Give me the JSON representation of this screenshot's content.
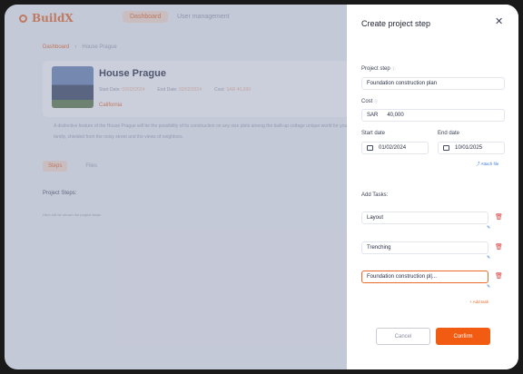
{
  "app": {
    "logo_text": "BuildX",
    "nav": [
      "Dashboard",
      "User management"
    ]
  },
  "breadcrumb": [
    "Dashboard",
    "House Prague"
  ],
  "project": {
    "title": "House Prague",
    "start_label": "Start Date:",
    "start_value": "02/02/2024",
    "end_label": "End Date:",
    "end_value": "02/02/2024",
    "cost_label": "Cost:",
    "cost_value": "SAR 40,000",
    "location": "California",
    "description": "A distinctive feature of the House Prague will be the possibility of its construction on any size plots among the built-up cottage unique world for your family, shielded from the noisy street and the views of neighbors."
  },
  "tabs": [
    "Steps",
    "Files"
  ],
  "steps": {
    "heading": "Project Steps:",
    "empty": "Here will be shown the project steps"
  },
  "panel": {
    "title": "Create project step",
    "step_label": "Project step",
    "step_value": "Foundation construction plan",
    "cost_label": "Cost",
    "currency": "SAR",
    "cost_value": "40,000",
    "start_label": "Start date",
    "start_value": "01/02/2024",
    "end_label": "End date",
    "end_value": "10/01/2025",
    "attach": "Attach file",
    "tasks_label": "Add Tasks:",
    "tasks": [
      "Layout",
      "Trenching",
      "Foundation construction pl|..."
    ],
    "add_task": "+ Add task",
    "cancel": "Cancel",
    "confirm": "Confirm"
  },
  "colors": {
    "accent": "#f25c12",
    "link": "#3b78d6",
    "danger": "#d64545"
  }
}
